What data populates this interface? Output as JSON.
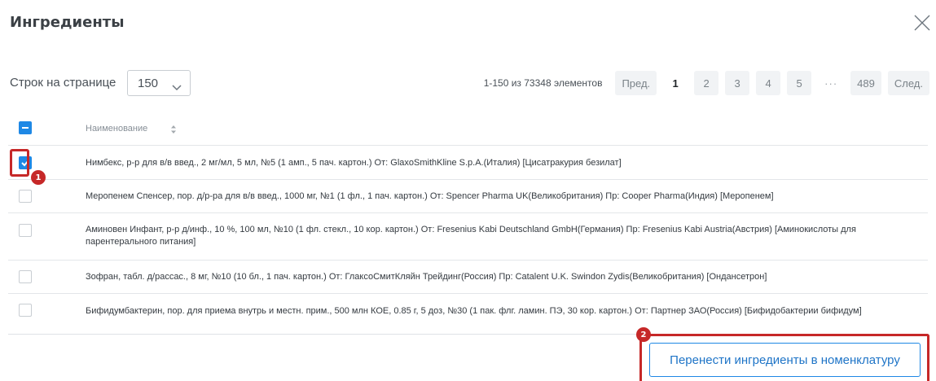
{
  "dialog": {
    "title": "Ингредиенты"
  },
  "toolbar": {
    "rows_label": "Строк на странице",
    "rows_value": "150"
  },
  "pagination": {
    "count_text": "1-150 из 73348 элементов",
    "prev": "Пред.",
    "pages": [
      "1",
      "2",
      "3",
      "4",
      "5"
    ],
    "active_page": "1",
    "ellipsis": "···",
    "last_page": "489",
    "next": "След."
  },
  "table": {
    "column_header": "Наименование",
    "rows": [
      {
        "text": "Нимбекс, р-р для в/в введ., 2 мг/мл, 5 мл, №5 (1 амп., 5 пач. картон.) От: GlaxoSmithKline S.p.A.(Италия) [Цисатракурия безилат]",
        "checked": true
      },
      {
        "text": "Меропенем Спенсер, пор. д/р-ра для в/в введ., 1000 мг, №1 (1 фл., 1 пач. картон.) От: Spencer Pharma UK(Великобритания) Пр: Cooper Pharma(Индия) [Меропенем]",
        "checked": false
      },
      {
        "text": "Аминовен Инфант, р-р д/инф., 10 %, 100 мл, №10 (1 фл. стекл., 10 кор. картон.) От: Fresenius Kabi Deutschland GmbH(Германия) Пр: Fresenius Kabi Austria(Австрия) [Аминокислоты для парентерального питания]",
        "checked": false
      },
      {
        "text": "Зофран, табл. д/рассас., 8 мг, №10 (10 бл., 1 пач. картон.) От: ГлаксоСмитКляйн Трейдинг(Россия) Пр: Catalent U.K. Swindon Zydis(Великобритания) [Ондансетрон]",
        "checked": false
      },
      {
        "text": "Бифидумбактерин, пор. для приема внутрь и местн. прим., 500 млн КОЕ, 0.85 г, 5 доз, №30 (1 пак. флг. ламин. ПЭ, 30 кор. картон.) От: Партнер ЗАО(Россия) [Бифидобактерии бифидум]",
        "checked": false
      }
    ]
  },
  "annotations": {
    "marker_1": "1",
    "marker_2": "2",
    "highlight_color": "#c62828"
  },
  "footer": {
    "submit_label": "Перенести ингредиенты в номенклатуру"
  },
  "colors": {
    "accent": "#1e88e5",
    "text": "#343a40"
  },
  "icons": {
    "close": "close-icon",
    "chevron": "chevron-down-icon",
    "sort": "sort-icon",
    "check": "checkmark-icon",
    "minus": "minus-icon"
  }
}
